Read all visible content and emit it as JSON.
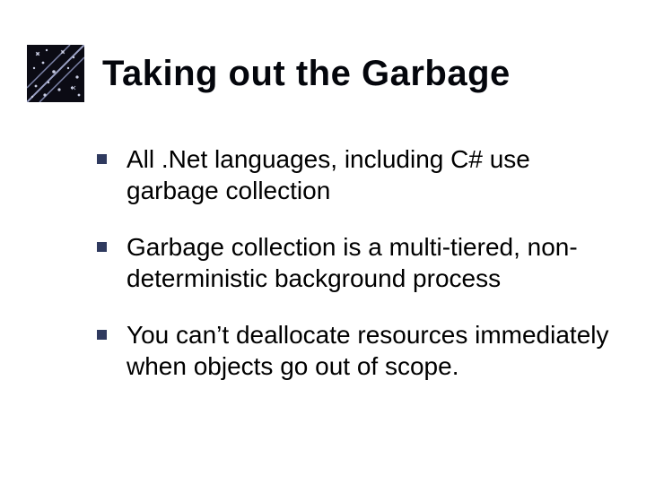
{
  "slide": {
    "title": "Taking out the Garbage",
    "bullets": [
      "All .Net languages, including C# use garbage collection",
      "Garbage collection is a multi-tiered, non-deterministic background process",
      "You can’t deallocate resources immediately when objects go out of scope."
    ]
  }
}
